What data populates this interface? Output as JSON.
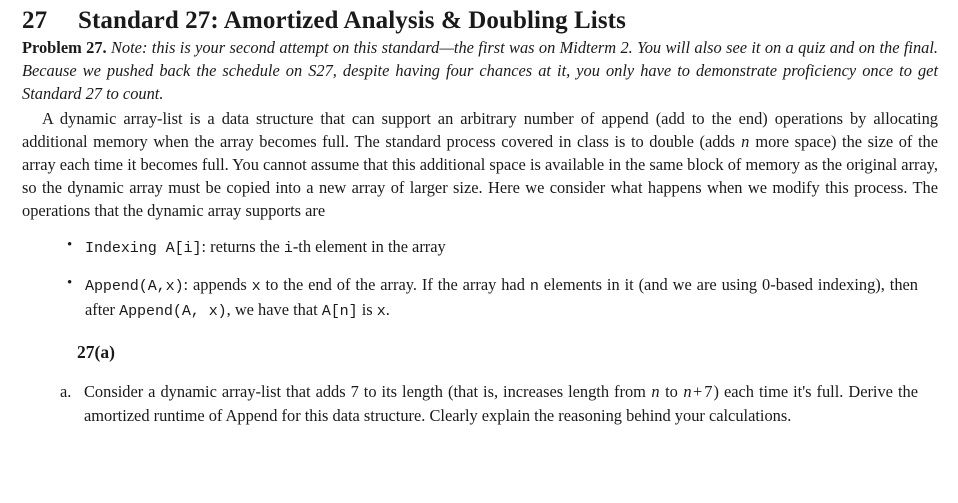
{
  "document": {
    "section": {
      "number": "27",
      "title": "Standard 27: Amortized Analysis & Doubling Lists"
    },
    "problem": {
      "label": "Problem 27.",
      "note": "Note: this is your second attempt on this standard—the first was on Midterm 2. You will also see it on a quiz and on the final. Because we pushed back the schedule on S27, despite having four chances at it, you only have to demonstrate proficiency once to get Standard 27 to count."
    },
    "intro": {
      "part1": "A dynamic array-list is a data structure that can support an arbitrary number of append (add to the end) operations by allocating additional memory when the array becomes full. The standard process covered in class is to double (adds ",
      "math_n": "n",
      "part2": " more space) the size of the array each time it becomes full. You cannot assume that this additional space is available in the same block of memory as the original array, so the dynamic array must be copied into a new array of larger size. Here we consider what happens when we modify this process. The operations that the dynamic array supports are"
    },
    "operations": [
      {
        "code_1": "Indexing A[i]",
        "text_1": ": returns the ",
        "code_2": "i",
        "text_2": "-th element in the array"
      },
      {
        "code_1": "Append(A,x)",
        "text_1": ": appends ",
        "code_2": "x",
        "text_2": " to the end of the array. If the array had ",
        "code_3": "n",
        "text_3": " elements in it (and we are using 0-based indexing), then after ",
        "code_4": "Append(A,  x)",
        "text_4": ", we have that ",
        "code_5": "A[n]",
        "text_5": " is ",
        "code_6": "x",
        "text_6": "."
      }
    ],
    "subpart": {
      "heading": "27(a)"
    },
    "questions": [
      {
        "marker": "a.",
        "text_1": "Consider a dynamic array-list that adds 7 to its length (that is, increases length from ",
        "math_1": "n",
        "text_2": " to ",
        "math_2": "n",
        "math_op": "+",
        "math_3": "7",
        "text_3": ") each time it's full. Derive the amortized runtime of Append for this data structure. Clearly explain the reasoning behind your calculations."
      }
    ]
  }
}
